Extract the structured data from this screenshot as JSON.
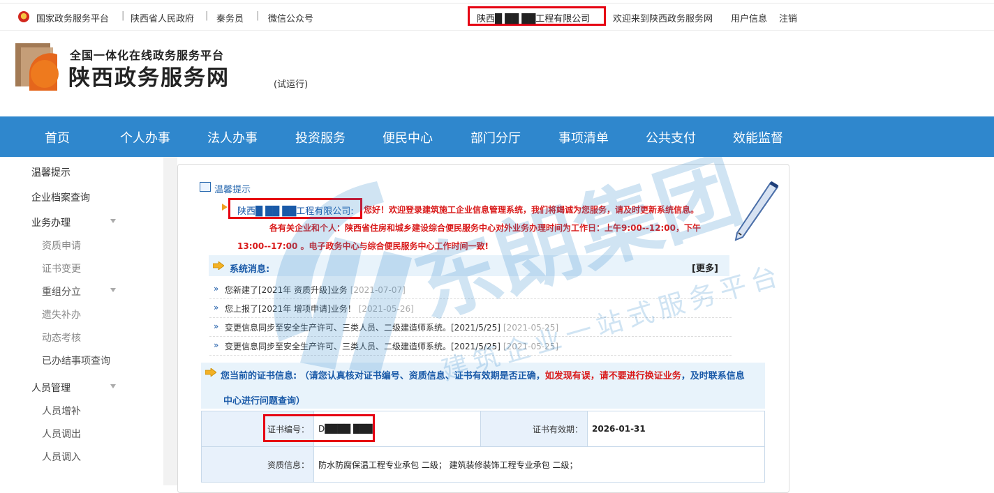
{
  "topbar": {
    "links": [
      "国家政务服务平台",
      "陕西省人民政府",
      "秦务员",
      "微信公众号"
    ],
    "company": "陕西█ ██ ██工程有限公司",
    "welcome": "欢迎来到陕西政务服务网",
    "user_info": "用户信息",
    "logout": "注销"
  },
  "header": {
    "subtitle": "全国一体化在线政务服务平台",
    "title": "陕西政务服务网",
    "trial": "(试运行)"
  },
  "nav": [
    "首页",
    "个人办事",
    "法人办事",
    "投资服务",
    "便民中心",
    "部门分厅",
    "事项清单",
    "公共支付",
    "效能监督"
  ],
  "sidebar": {
    "items": [
      {
        "label": "温馨提示",
        "level": 1
      },
      {
        "label": "企业档案查询",
        "level": 1
      },
      {
        "label": "业务办理",
        "level": 1,
        "expandable": true
      },
      {
        "label": "资质申请",
        "level": 2
      },
      {
        "label": "证书变更",
        "level": 2
      },
      {
        "label": "重组分立",
        "level": 2,
        "expandable": true
      },
      {
        "label": "遗失补办",
        "level": 2
      },
      {
        "label": "动态考核",
        "level": 2
      },
      {
        "label": "已办结事项查询",
        "level": 2
      },
      {
        "label": "人员管理",
        "level": 1,
        "expandable": true
      },
      {
        "label": "人员增补",
        "level": 2
      },
      {
        "label": "人员调出",
        "level": 2
      },
      {
        "label": "人员调入",
        "level": 2
      }
    ]
  },
  "notice": {
    "title": "温馨提示",
    "company": "陕西█ ██ ██工程有限公司:",
    "greeting": "您好！欢迎登录建筑施工企业信息管理系统，我们将竭诚为您服务，请及时更新系统信息。",
    "line2": "各有关企业和个人：陕西省住房和城乡建设综合便民服务中心对外业务办理时间为工作日：上午9:00--12:00，下午",
    "line3": "13:00--17:00 。电子政务中心与综合便民服务中心工作时间一致!"
  },
  "messages": {
    "title": "系统消息:",
    "more": "[更多]",
    "items": [
      {
        "text": "您新建了[2021年 资质升级]业务",
        "date": "[2021-07-07]"
      },
      {
        "text": "您上报了[2021年 增项申请]业务！",
        "date": "[2021-05-26]"
      },
      {
        "text": "变更信息同步至安全生产许可、三类人员、二级建造师系统。[2021/5/25]",
        "date": "[2021-05-25]"
      },
      {
        "text": "变更信息同步至安全生产许可、三类人员、二级建造师系统。[2021/5/25]",
        "date": "[2021-05-25]"
      }
    ]
  },
  "certificate": {
    "header_a": "您当前的证书信息:  （请您认真核对证书编号、资质信息、证书有效期是否正确，",
    "header_b": "如发现有误，请不要进行换证业务",
    "header_c": "，及时联系信息",
    "header_d": "中心进行问题查询）",
    "number_label": "证书编号：",
    "number_value": "D████ ███",
    "expiry_label": "证书有效期：",
    "expiry_value": "2026-01-31",
    "quals_label": "资质信息：",
    "quals_value": "防水防腐保温工程专业承包 二级；  建筑装修装饰工程专业承包 二级；"
  },
  "watermark": {
    "big": "东朗集团",
    "line": "建筑企业一站式服务平台"
  },
  "colors": {
    "nav_blue": "#2f87cd",
    "highlight_red": "#e60012",
    "link_blue": "#1a5aa8",
    "notice_red": "#d91a1a"
  }
}
